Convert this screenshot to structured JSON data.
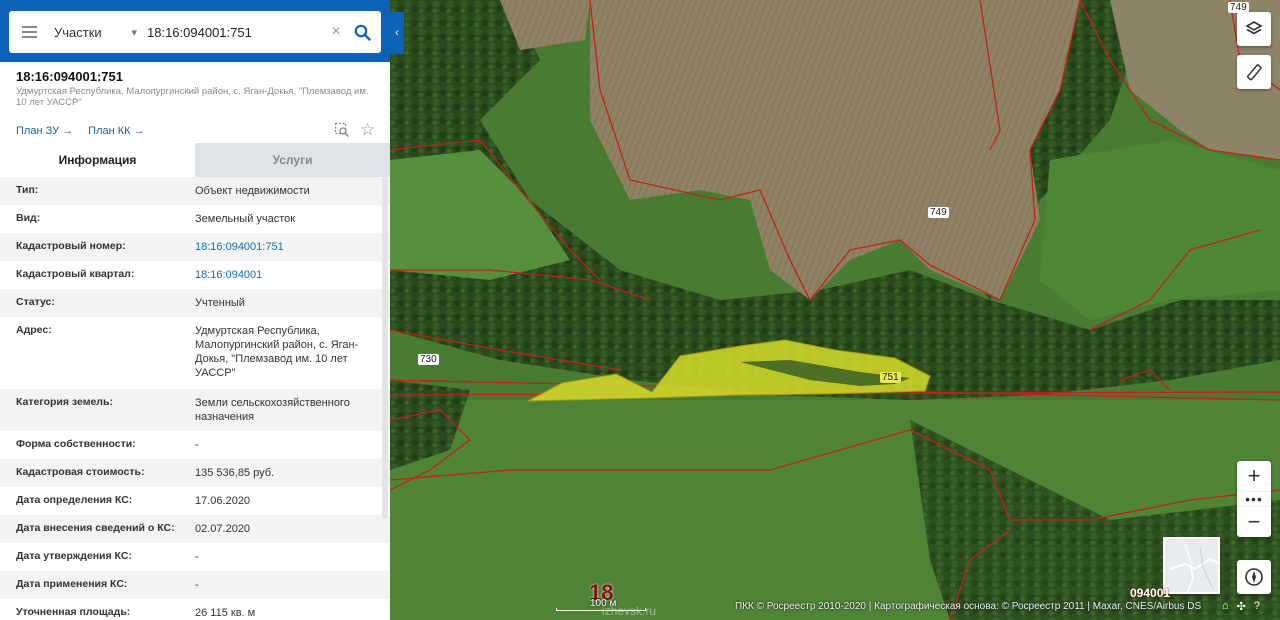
{
  "search": {
    "type_label": "Участки",
    "query": "18:16:094001:751"
  },
  "object": {
    "title": "18:16:094001:751",
    "address": "Удмуртская Республика, Малопургинский район, с. Яган-Докья, \"Племзавод им. 10 лет УАССР\"",
    "plan_zu": "План ЗУ",
    "plan_kk": "План КК"
  },
  "tabs": {
    "info": "Информация",
    "services": "Услуги"
  },
  "rows": [
    {
      "k": "Тип:",
      "v": "Объект недвижимости",
      "link": false
    },
    {
      "k": "Вид:",
      "v": "Земельный участок",
      "link": false
    },
    {
      "k": "Кадастровый номер:",
      "v": "18:16:094001:751",
      "link": true
    },
    {
      "k": "Кадастровый квартал:",
      "v": "18:16:094001",
      "link": true
    },
    {
      "k": "Статус:",
      "v": "Учтенный",
      "link": false
    },
    {
      "k": "Адрес:",
      "v": "Удмуртская Республика, Малопургинский район, с. Яган-Докья, \"Племзавод им. 10 лет УАССР\"",
      "link": false
    },
    {
      "k": "Категория земель:",
      "v": "Земли сельскохозяйственного назначения",
      "link": false
    },
    {
      "k": "Форма собственности:",
      "v": "-",
      "link": false
    },
    {
      "k": "Кадастровая стоимость:",
      "v": "135 536,85 руб.",
      "link": false
    },
    {
      "k": "Дата определения КС:",
      "v": "17.06.2020",
      "link": false
    },
    {
      "k": "Дата внесения сведений о КС:",
      "v": "02.07.2020",
      "link": false
    },
    {
      "k": "Дата утверждения КС:",
      "v": "-",
      "link": false
    },
    {
      "k": "Дата применения КС:",
      "v": "-",
      "link": false
    },
    {
      "k": "Уточненная площадь:",
      "v": "26 115 кв. м",
      "link": false
    }
  ],
  "map": {
    "parcel_labels": {
      "p749a": "749",
      "p749b": "749",
      "p730": "730",
      "p751": "751"
    },
    "scale_number": "18",
    "scale_label": "100 м",
    "watermark": "izhevsk.ru",
    "quarter": "094001",
    "attribution": "ПКК © Росреестр 2010-2020 | Картографическая основа: © Росреестр 2011 | Maxar, CNES/Airbus DS",
    "parcel_fill": "#d6dc2a",
    "boundary_color": "#c0221b"
  }
}
